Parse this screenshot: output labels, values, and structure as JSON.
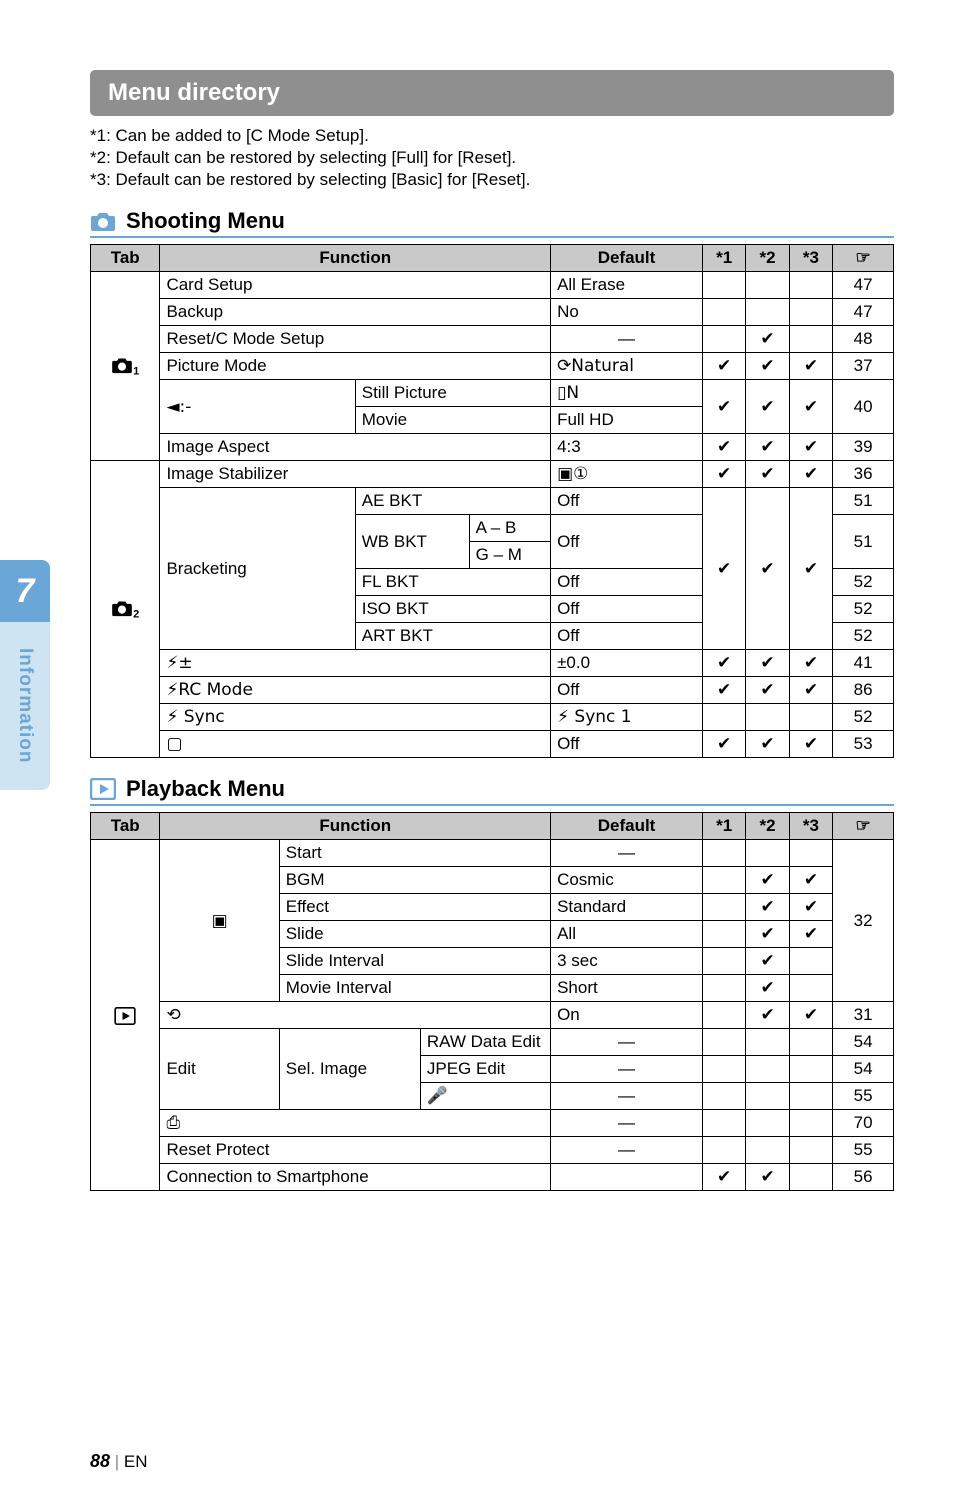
{
  "title": "Menu directory",
  "notes": {
    "n1": "*1: Can be added to [C Mode Setup].",
    "n2": "*2: Default can be restored by selecting [Full] for [Reset].",
    "n3": "*3: Default can be restored by selecting [Basic] for [Reset]."
  },
  "sections": {
    "shooting": "Shooting Menu",
    "playback": "Playback Menu"
  },
  "headers": {
    "tab": "Tab",
    "function": "Function",
    "default": "Default",
    "s1": "*1",
    "s2": "*2",
    "s3": "*3",
    "pg": "☞"
  },
  "shoot": {
    "card_setup": {
      "fn": "Card Setup",
      "def": "All Erase",
      "pg": "47"
    },
    "backup": {
      "fn": "Backup",
      "def": "No",
      "pg": "47"
    },
    "reset_c": {
      "fn": "Reset/C Mode Setup",
      "def": "—",
      "s2": "✔",
      "pg": "48"
    },
    "picture_mode": {
      "fn": "Picture Mode",
      "def": "⟳Natural",
      "s1": "✔",
      "s2": "✔",
      "s3": "✔",
      "pg": "37"
    },
    "quality": {
      "fn": "◄:-",
      "still": "Still Picture",
      "still_def": "▯N",
      "movie": "Movie",
      "movie_def": "Full HD",
      "s1": "✔",
      "s2": "✔",
      "s3": "✔",
      "pg": "40"
    },
    "aspect": {
      "fn": "Image Aspect",
      "def": "4:3",
      "s1": "✔",
      "s2": "✔",
      "s3": "✔",
      "pg": "39"
    },
    "stabilizer": {
      "fn": "Image Stabilizer",
      "def": "▣①",
      "s1": "✔",
      "s2": "✔",
      "s3": "✔",
      "pg": "36"
    },
    "bracketing": {
      "fn": "Bracketing",
      "s1": "✔",
      "s2": "✔",
      "s3": "✔",
      "ae": {
        "fn": "AE BKT",
        "def": "Off",
        "pg": "51"
      },
      "wb": {
        "fn": "WB BKT",
        "ab": "A – B",
        "gm": "G – M",
        "def": "Off",
        "pg": "51"
      },
      "fl": {
        "fn": "FL BKT",
        "def": "Off",
        "pg": "52"
      },
      "iso": {
        "fn": "ISO BKT",
        "def": "Off",
        "pg": "52"
      },
      "art": {
        "fn": "ART BKT",
        "def": "Off",
        "pg": "52"
      }
    },
    "flash_comp": {
      "fn": "⚡±",
      "def": "±0.0",
      "s1": "✔",
      "s2": "✔",
      "s3": "✔",
      "pg": "41"
    },
    "rc_mode": {
      "fn": "⚡RC Mode",
      "def": "Off",
      "s1": "✔",
      "s2": "✔",
      "s3": "✔",
      "pg": "86"
    },
    "flash_sync": {
      "fn": "⚡ Sync",
      "def": "⚡ Sync 1",
      "pg": "52"
    },
    "interval": {
      "fn": "▢",
      "def": "Off",
      "s1": "✔",
      "s2": "✔",
      "s3": "✔",
      "pg": "53"
    }
  },
  "play": {
    "slideshow": {
      "fn": "▣",
      "start": {
        "fn": "Start",
        "def": "—"
      },
      "bgm": {
        "fn": "BGM",
        "def": "Cosmic",
        "s2": "✔",
        "s3": "✔"
      },
      "effect": {
        "fn": "Effect",
        "def": "Standard",
        "s2": "✔",
        "s3": "✔"
      },
      "slide": {
        "fn": "Slide",
        "def": "All",
        "s2": "✔",
        "s3": "✔"
      },
      "slide_int": {
        "fn": "Slide Interval",
        "def": "3 sec",
        "s2": "✔"
      },
      "movie_int": {
        "fn": "Movie Interval",
        "def": "Short",
        "s2": "✔"
      },
      "pg": "32"
    },
    "rotate": {
      "fn": "⟲",
      "def": "On",
      "s2": "✔",
      "s3": "✔",
      "pg": "31"
    },
    "edit": {
      "fn": "Edit",
      "sel": "Sel. Image",
      "raw": {
        "fn": "RAW Data Edit",
        "def": "—",
        "pg": "54"
      },
      "jpeg": {
        "fn": "JPEG Edit",
        "def": "—",
        "pg": "54"
      },
      "voice": {
        "fn": "🎤",
        "def": "—",
        "pg": "55"
      }
    },
    "print": {
      "fn": "⎙",
      "def": "—",
      "pg": "70"
    },
    "reset_protect": {
      "fn": "Reset Protect",
      "def": "—",
      "pg": "55"
    },
    "smartphone": {
      "fn": "Connection to Smartphone",
      "s1": "✔",
      "s2": "✔",
      "pg": "56"
    }
  },
  "side": {
    "num": "7",
    "label": "Information"
  },
  "footer": {
    "pg": "88",
    "lang": "EN"
  }
}
